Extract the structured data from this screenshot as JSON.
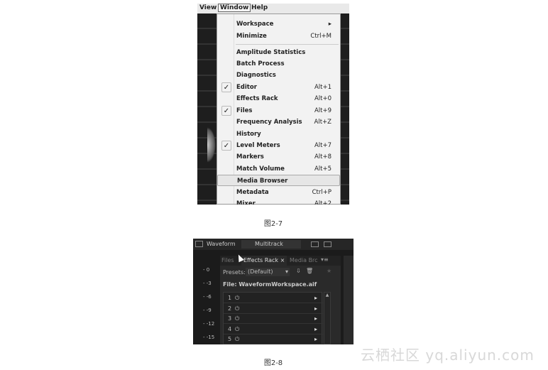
{
  "figure1": {
    "menubar": [
      "View",
      "Window",
      "Help"
    ],
    "active_menu": "Window",
    "items": [
      {
        "label": "Workspace",
        "shortcut": "",
        "submenu": true,
        "checked": false
      },
      {
        "label": "Minimize",
        "shortcut": "Ctrl+M",
        "checked": false
      },
      {
        "label": "Amplitude Statistics",
        "shortcut": "",
        "checked": false
      },
      {
        "label": "Batch Process",
        "shortcut": "",
        "checked": false
      },
      {
        "label": "Diagnostics",
        "shortcut": "",
        "checked": false
      },
      {
        "label": "Editor",
        "shortcut": "Alt+1",
        "checked": true
      },
      {
        "label": "Effects Rack",
        "shortcut": "Alt+0",
        "checked": false
      },
      {
        "label": "Files",
        "shortcut": "Alt+9",
        "checked": true
      },
      {
        "label": "Frequency Analysis",
        "shortcut": "Alt+Z",
        "checked": false
      },
      {
        "label": "History",
        "shortcut": "",
        "checked": false
      },
      {
        "label": "Level Meters",
        "shortcut": "Alt+7",
        "checked": true
      },
      {
        "label": "Markers",
        "shortcut": "Alt+8",
        "checked": false
      },
      {
        "label": "Match Volume",
        "shortcut": "Alt+5",
        "checked": false
      },
      {
        "label": "Media Browser",
        "shortcut": "",
        "checked": false,
        "highlighted": true
      },
      {
        "label": "Metadata",
        "shortcut": "Ctrl+P",
        "checked": false
      },
      {
        "label": "Mixer",
        "shortcut": "Alt+2",
        "checked": false
      }
    ],
    "caption": "图2-7"
  },
  "figure2": {
    "toolbar": {
      "waveform": "Waveform",
      "multitrack": "Multitrack"
    },
    "tabs": [
      "Files",
      "Effects Rack",
      "Media Brc"
    ],
    "presets_label": "Presets:",
    "presets_value": "(Default)",
    "file_label": "File: WaveformWorkspace.aif",
    "rows": [
      "1",
      "2",
      "3",
      "4",
      "5"
    ],
    "ruler": [
      "0",
      "-3",
      "-6",
      "-9",
      "-12",
      "-15"
    ],
    "caption": "图2-8"
  },
  "watermark": "云栖社区 yq.aliyun.com"
}
